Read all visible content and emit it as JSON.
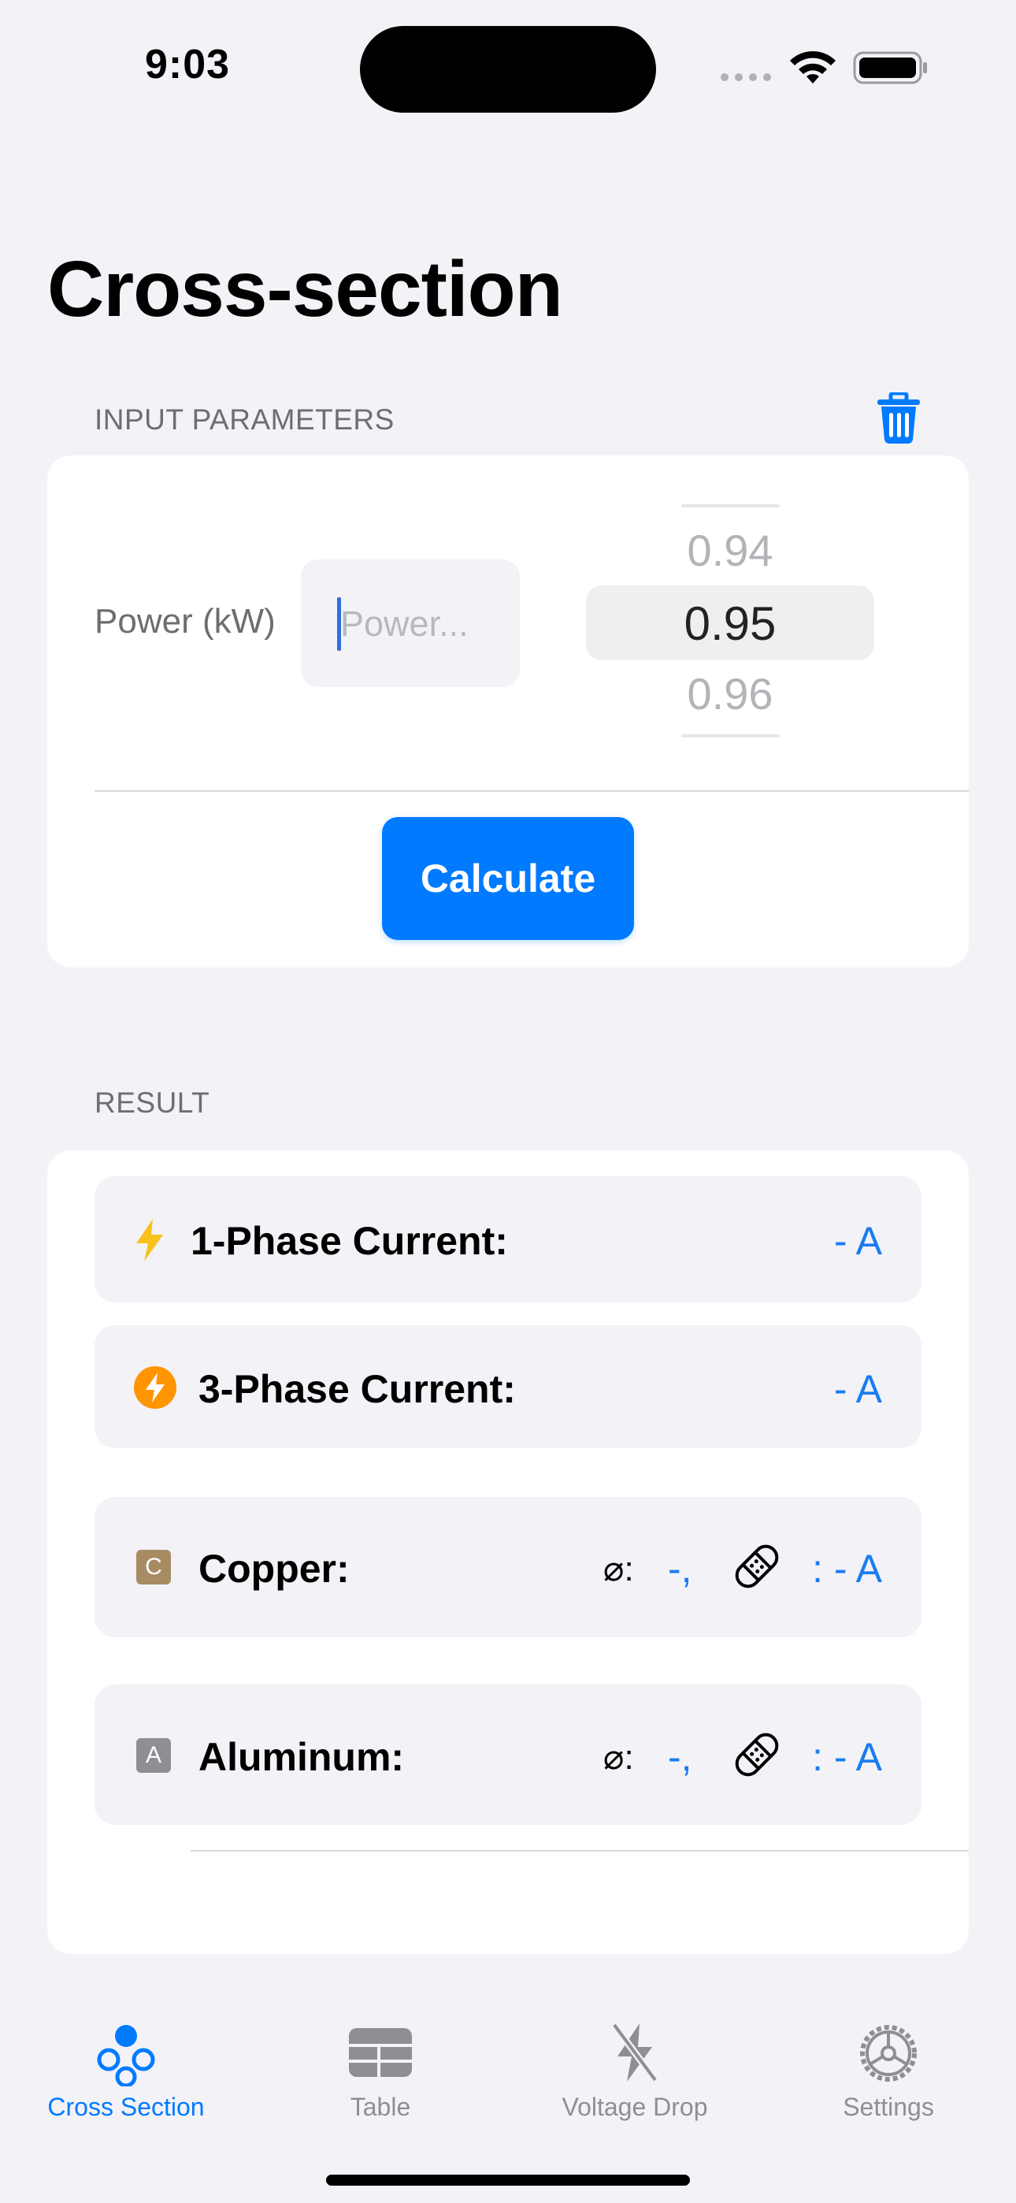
{
  "status_bar": {
    "time": "9:03"
  },
  "page": {
    "title": "Cross-section"
  },
  "input_section": {
    "header": "INPUT PARAMETERS",
    "power_label": "Power (kW)",
    "power_value": "",
    "power_placeholder": "Power...",
    "picker_values": [
      "0.94",
      "0.95",
      "0.96"
    ],
    "picker_selected": "0.95",
    "calculate_label": "Calculate"
  },
  "result_section": {
    "header": "RESULT",
    "single_phase": {
      "label": "1-Phase Current:",
      "value": "- A"
    },
    "three_phase": {
      "label": "3-Phase Current:",
      "value": "- A"
    },
    "copper": {
      "chip": "C",
      "label": "Copper:",
      "diameter_symbol": "⌀:",
      "diameter_value": "-,",
      "current_value": ": - A"
    },
    "aluminum": {
      "chip": "A",
      "label": "Aluminum:",
      "diameter_symbol": "⌀:",
      "diameter_value": "-,",
      "current_value": ": - A"
    }
  },
  "tab_bar": {
    "tabs": [
      {
        "label": "Cross Section",
        "active": true
      },
      {
        "label": "Table",
        "active": false
      },
      {
        "label": "Voltage Drop",
        "active": false
      },
      {
        "label": "Settings",
        "active": false
      }
    ]
  },
  "colors": {
    "accent": "#007aff",
    "background": "#f2f2f7",
    "copper_chip": "#a78b63",
    "aluminum_chip": "#8e8e93",
    "bolt_yellow": "#f7c21a",
    "bolt_orange": "#ff9500"
  }
}
